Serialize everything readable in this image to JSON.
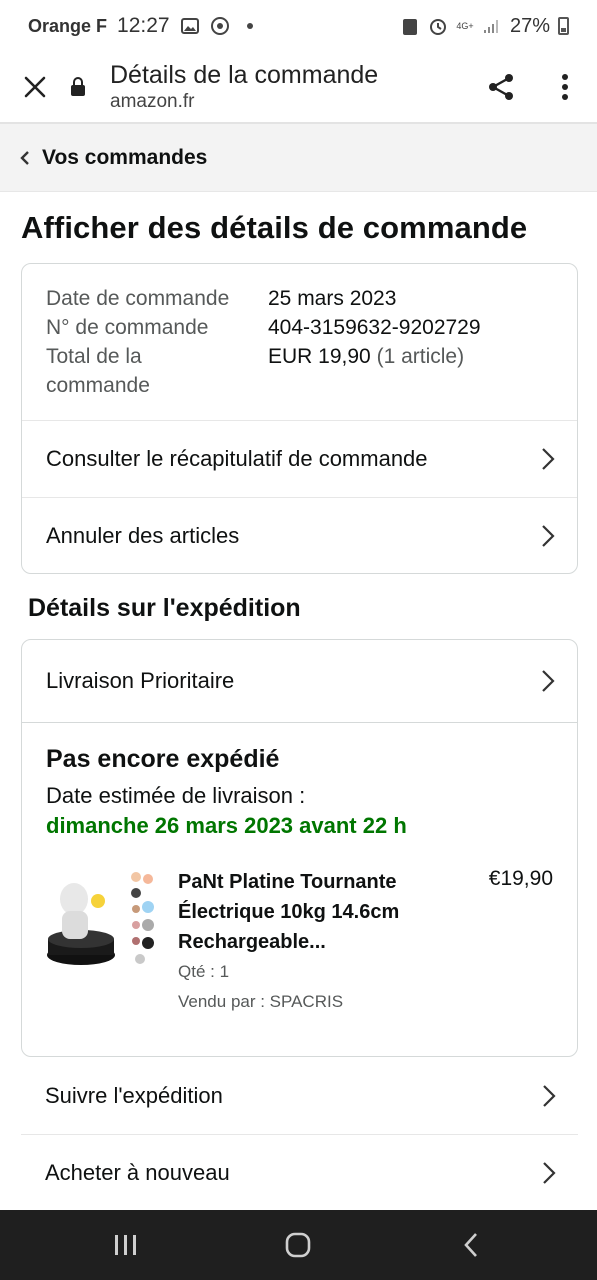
{
  "status_bar": {
    "carrier": "Orange F",
    "time": "12:27",
    "network": "4G+",
    "battery": "27%"
  },
  "browser": {
    "title": "Détails de la commande",
    "domain": "amazon.fr"
  },
  "breadcrumb": {
    "label": "Vos commandes"
  },
  "page": {
    "title": "Afficher des détails de commande"
  },
  "order_info": {
    "rows": [
      {
        "label": "Date de commande",
        "value": "25 mars 2023",
        "extra": ""
      },
      {
        "label": "N° de commande",
        "value": "404-3159632-9202729",
        "extra": ""
      },
      {
        "label": "Total de la commande",
        "value": "EUR 19,90",
        "extra": "(1 article)"
      }
    ],
    "links": [
      {
        "label": "Consulter le récapitulatif de commande"
      },
      {
        "label": "Annuler des articles"
      }
    ]
  },
  "shipping": {
    "section_title": "Détails sur l'expédition",
    "method": "Livraison Prioritaire",
    "status": "Pas encore expédié",
    "eta_label": "Date estimée de livraison :",
    "eta_date": "dimanche 26 mars 2023 avant 22 h",
    "product": {
      "name": "PaNt Platine Tournante Électrique 10kg 14.6cm Rechargeable...",
      "qty": "Qté : 1",
      "seller": "Vendu par : SPACRIS",
      "price": "€19,90"
    }
  },
  "actions": [
    {
      "label": "Suivre l'expédition"
    },
    {
      "label": "Acheter à nouveau"
    }
  ],
  "colors": {
    "eta_green": "#007600",
    "border": "#d5d9d9",
    "crumb_bg": "#f3f3f3"
  }
}
